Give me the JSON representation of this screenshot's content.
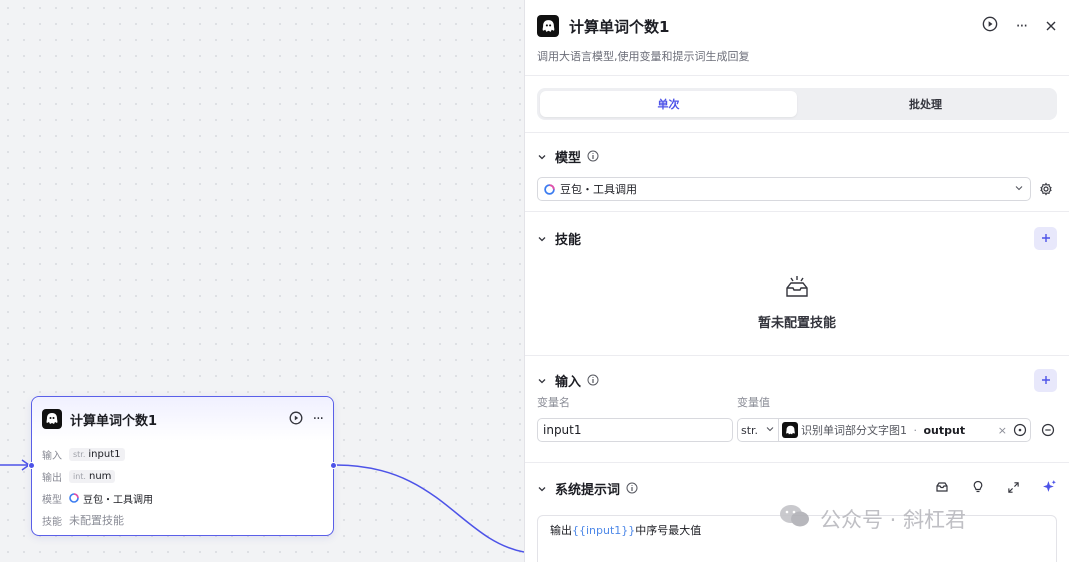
{
  "node": {
    "title": "计算单词个数1",
    "rows": {
      "input_key": "输入",
      "input_type": "str.",
      "input_value": "input1",
      "output_key": "输出",
      "output_type": "int.",
      "output_value": "num",
      "model_key": "模型",
      "model_value": "豆包・工具调用",
      "skill_key": "技能",
      "skill_value": "未配置技能"
    }
  },
  "panel": {
    "title": "计算单词个数1",
    "description": "调用大语言模型,使用变量和提示词生成回复",
    "tabs": [
      {
        "label": "单次",
        "active": true
      },
      {
        "label": "批处理",
        "active": false
      }
    ],
    "model_section": {
      "title": "模型",
      "selected": "豆包・工具调用"
    },
    "skills_section": {
      "title": "技能",
      "empty_text": "暂未配置技能"
    },
    "input_section": {
      "title": "输入",
      "col_name_label": "变量名",
      "col_value_label": "变量值",
      "var_name": "input1",
      "var_type": "str.",
      "ref_node": "识别单词部分文字图1",
      "ref_sep": " · ",
      "ref_field": "output"
    },
    "prompt_section": {
      "title": "系统提示词",
      "text_before": "输出",
      "text_var": "{{input1}}",
      "text_after": "中序号最大值"
    }
  },
  "watermark": {
    "text": "公众号 · 斜杠君"
  },
  "colors": {
    "accent": "#4d53e8",
    "edge": "#4d53e8",
    "variable": "#4d88e8"
  }
}
